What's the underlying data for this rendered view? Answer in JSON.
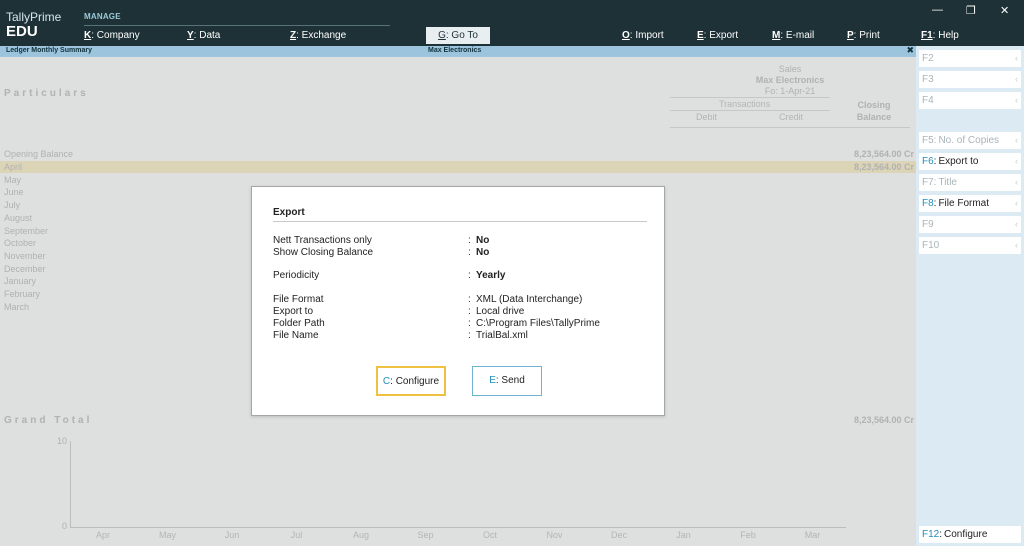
{
  "app": {
    "name": "TallyPrime",
    "edition": "EDU",
    "menu_section": "MANAGE"
  },
  "menu": {
    "company": {
      "key": "K",
      "label": ": Company"
    },
    "data": {
      "key": "Y",
      "label": ": Data"
    },
    "exchange": {
      "key": "Z",
      "label": ": Exchange"
    },
    "goto": {
      "key": "G",
      "label": ": Go To"
    },
    "import": {
      "key": "O",
      "label": ": Import"
    },
    "export": {
      "key": "E",
      "label": ": Export"
    },
    "email": {
      "key": "M",
      "label": ": E-mail"
    },
    "print": {
      "key": "P",
      "label": ": Print"
    },
    "help": {
      "key": "F1",
      "label": ": Help"
    }
  },
  "window_controls": {
    "minimize": "—",
    "restore": "❐",
    "close": "✕"
  },
  "report": {
    "title": "Ledger Monthly Summary",
    "company": "Max Electronics",
    "close": "✖",
    "particulars": "Particulars",
    "ledger": "Sales",
    "company_sub": "Max Electronics",
    "period": "Fo: 1-Apr-21",
    "transactions": "Transactions",
    "debit": "Debit",
    "credit": "Credit",
    "closing": "Closing",
    "balance": "Balance",
    "opening_balance": {
      "label": "Opening Balance",
      "value": "8,23,564.00 Cr"
    },
    "months": [
      {
        "label": "April",
        "value": "8,23,564.00 Cr"
      },
      {
        "label": "May",
        "value": ""
      },
      {
        "label": "June",
        "value": ""
      },
      {
        "label": "July",
        "value": ""
      },
      {
        "label": "August",
        "value": ""
      },
      {
        "label": "September",
        "value": ""
      },
      {
        "label": "October",
        "value": ""
      },
      {
        "label": "November",
        "value": ""
      },
      {
        "label": "December",
        "value": ""
      },
      {
        "label": "January",
        "value": ""
      },
      {
        "label": "February",
        "value": ""
      },
      {
        "label": "March",
        "value": ""
      }
    ],
    "grand_total": {
      "label": "Grand Total",
      "value": "8,23,564.00 Cr"
    },
    "graph": {
      "y_ticks": [
        "10",
        "0"
      ],
      "x_ticks": [
        "Apr",
        "May",
        "Jun",
        "Jul",
        "Aug",
        "Sep",
        "Oct",
        "Nov",
        "Dec",
        "Jan",
        "Feb",
        "Mar"
      ]
    }
  },
  "function_keys": [
    {
      "key": "F2",
      "label": "",
      "enabled": false
    },
    {
      "key": "F3",
      "label": "",
      "enabled": false
    },
    {
      "key": "F4",
      "label": "",
      "enabled": false
    },
    {
      "key": "F5",
      "label": "No. of Copies",
      "enabled": false
    },
    {
      "key": "F6",
      "label": "Export to",
      "enabled": true
    },
    {
      "key": "F7",
      "label": "Title",
      "enabled": false
    },
    {
      "key": "F8",
      "label": "File Format",
      "enabled": true
    },
    {
      "key": "F9",
      "label": "",
      "enabled": false
    },
    {
      "key": "F10",
      "label": "",
      "enabled": false
    },
    {
      "key": "F12",
      "label": "Configure",
      "enabled": true
    }
  ],
  "dialog": {
    "title": "Export",
    "fields": [
      {
        "label": "Nett Transactions only",
        "value": "No"
      },
      {
        "label": "Show Closing Balance",
        "value": "No"
      },
      {
        "label": "Periodicity",
        "value": "Yearly"
      },
      {
        "label": "File Format",
        "value": "XML (Data Interchange)"
      },
      {
        "label": "Export to",
        "value": "Local drive"
      },
      {
        "label": "Folder Path",
        "value": "C:\\Program Files\\TallyPrime"
      },
      {
        "label": "File Name",
        "value": "TrialBal.xml"
      }
    ],
    "colon": ":",
    "configure_button": {
      "key": "C",
      "label": ": Configure"
    },
    "send_button": {
      "key": "E",
      "label": ": Send"
    }
  },
  "colors": {
    "topbar": "#1e3137",
    "accent": "#1f8fb8",
    "title_bar": "#9cc4dc",
    "side_panel": "#dbeaf3",
    "highlight_row": "#f4ebc9",
    "focus_border": "#f0c040"
  }
}
